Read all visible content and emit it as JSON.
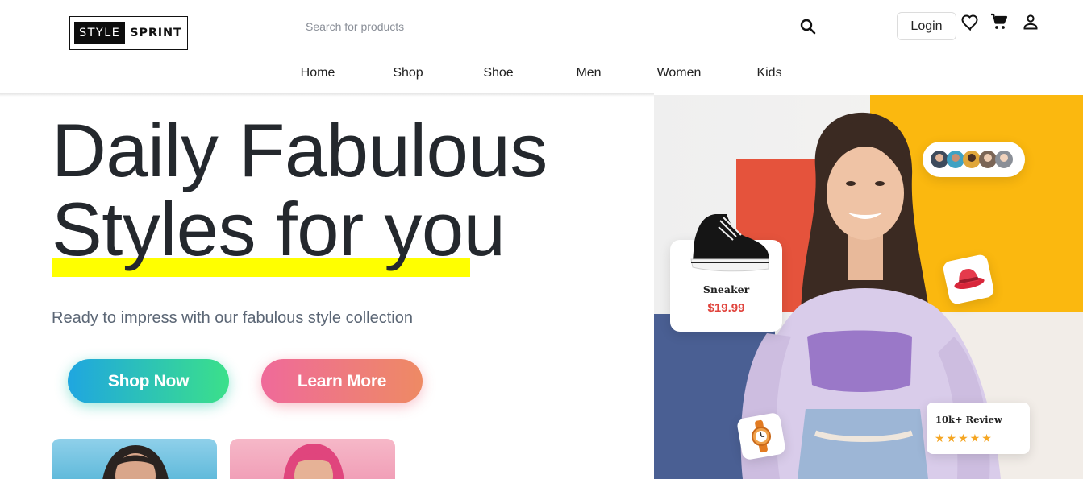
{
  "brand": {
    "logo_part1": "STYLE",
    "logo_part2": "SPRINT"
  },
  "search": {
    "placeholder": "Search for products",
    "value": ""
  },
  "header": {
    "login_label": "Login"
  },
  "icons": {
    "search": "search-icon",
    "wishlist": "heart-icon",
    "cart": "cart-icon",
    "account": "user-icon"
  },
  "nav": {
    "items": [
      {
        "label": "Home"
      },
      {
        "label": "Shop"
      },
      {
        "label": "Shoe"
      },
      {
        "label": "Men"
      },
      {
        "label": "Women"
      },
      {
        "label": "Kids"
      }
    ]
  },
  "hero": {
    "title_line1": "Daily Fabulous",
    "title_line2": "Styles for you",
    "subtitle": "Ready to impress with our fabulous style collection",
    "primary_cta": "Shop Now",
    "secondary_cta": "Learn More",
    "highlight_color": "#ffff00"
  },
  "showcase": {
    "product_name": "Sneaker",
    "product_price": "$19.99",
    "review_label": "10k+ Review",
    "rating_stars": 5,
    "stars_text": "★★★★★"
  },
  "colors": {
    "accent_yellow": "#fbb80f",
    "accent_red": "#e5533c",
    "accent_navy": "#4a5f93",
    "price_red": "#e0433c",
    "cta_shop_gradient": [
      "#1fa6e0",
      "#3be08a"
    ],
    "cta_learn_gradient": [
      "#ef6a9a",
      "#ee8a64"
    ]
  }
}
